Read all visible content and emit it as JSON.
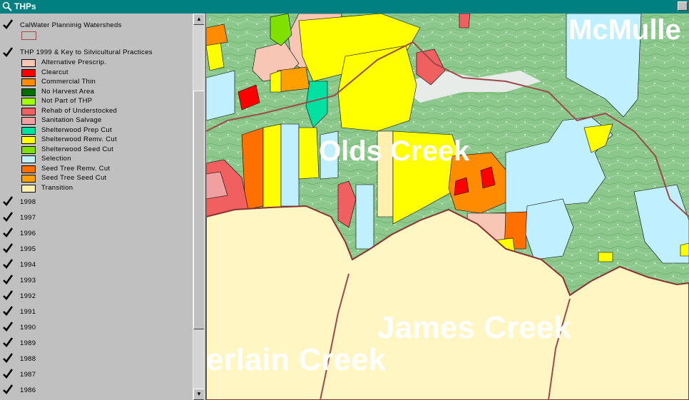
{
  "window": {
    "title": "THPs"
  },
  "toc": {
    "watersheds_layer": "CalWater Planninig Watersheds",
    "thp_layer": "THP 1999 & Key to Silvicultural Practices",
    "legend": [
      {
        "label": "Alternative Prescrip.",
        "color": "#f7c6b5"
      },
      {
        "label": "Clearcut",
        "color": "#ff0000"
      },
      {
        "label": "Commercial Thin",
        "color": "#ff8c00"
      },
      {
        "label": "No Harvest Area",
        "color": "#007000"
      },
      {
        "label": "Not Part of THP",
        "color": "#a0ff00"
      },
      {
        "label": "Rehab of Understocked",
        "color": "#f06060"
      },
      {
        "label": "Sanitation Salvage",
        "color": "#f0a0a0"
      },
      {
        "label": "Shelterwood Prep Cut",
        "color": "#00e0a0"
      },
      {
        "label": "Shelterwood Remv. Cut",
        "color": "#ffff00"
      },
      {
        "label": "Shelterwood Seed Cut",
        "color": "#80e000"
      },
      {
        "label": "Selection",
        "color": "#c0f0ff"
      },
      {
        "label": "Seed Tree Remv. Cut",
        "color": "#ff7000"
      },
      {
        "label": "Seed Tree Seed Cut",
        "color": "#ffa000"
      },
      {
        "label": "Transition",
        "color": "#fff0b0"
      }
    ],
    "years": [
      "1998",
      "1997",
      "1996",
      "1995",
      "1994",
      "1993",
      "1992",
      "1991",
      "1990",
      "1989",
      "1988",
      "1987",
      "1986"
    ]
  },
  "map": {
    "labels": {
      "mcmullen": "McMulle",
      "olds": "Olds Creek",
      "james": "James Creek",
      "chamberlain": "erlain Creek"
    }
  }
}
